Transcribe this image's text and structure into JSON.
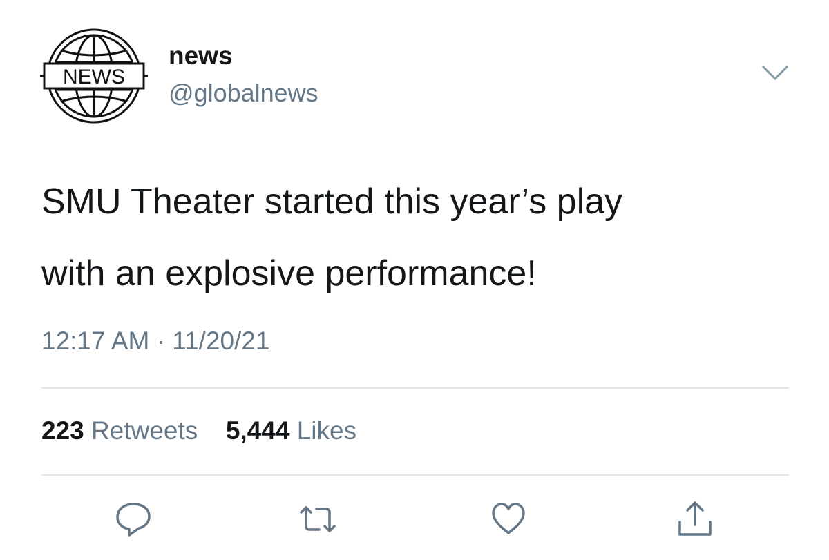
{
  "author": {
    "avatar_text": "NEWS",
    "name": "news",
    "handle": "@globalnews"
  },
  "tweet": {
    "lines": [
      "SMU Theater started this year’s play",
      "with an explosive performance!"
    ],
    "time": "12:17 AM",
    "separator": "·",
    "date": "11/20/21"
  },
  "stats": {
    "retweets_count": "223",
    "retweets_label": "Retweets",
    "likes_count": "5,444",
    "likes_label": "Likes"
  },
  "actions": [
    "reply-icon",
    "retweet-icon",
    "heart-icon",
    "share-icon"
  ],
  "colors": {
    "text_primary": "#14171a",
    "text_secondary": "#657786",
    "icon": "#657786",
    "divider": "#e1e8ed"
  }
}
